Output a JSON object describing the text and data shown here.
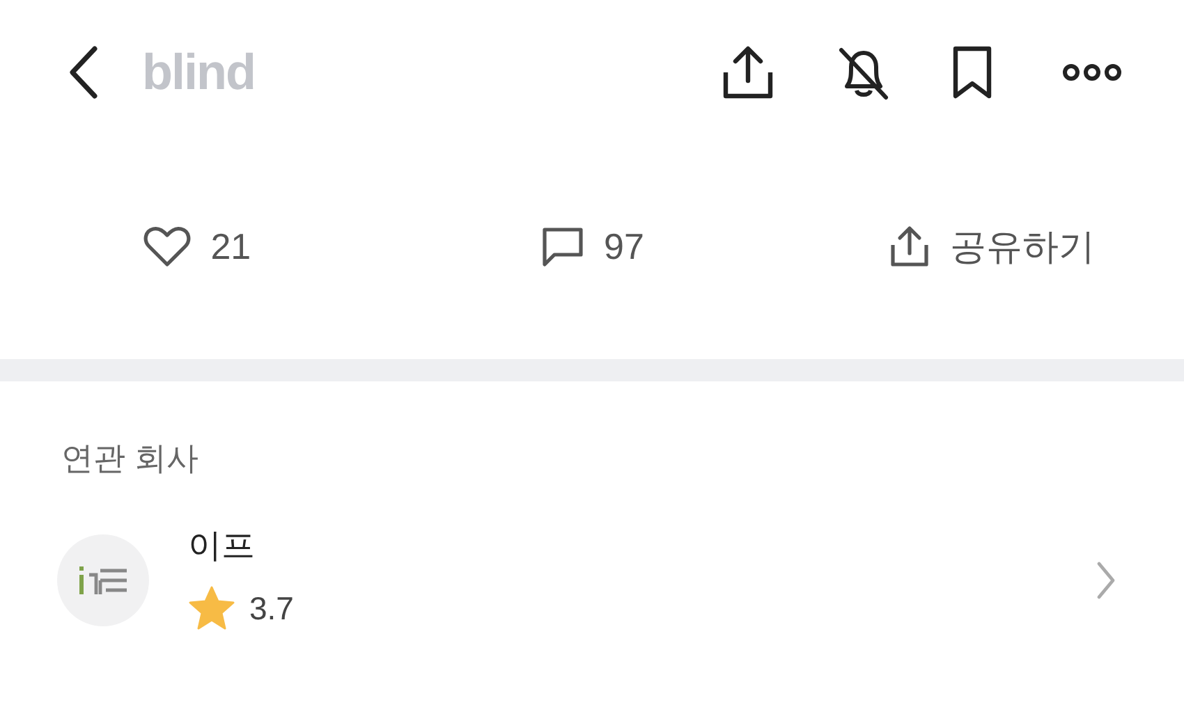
{
  "header": {
    "logo": "blind"
  },
  "actions": [
    {
      "kind": "like",
      "label": "21"
    },
    {
      "kind": "comment",
      "label": "97"
    },
    {
      "kind": "share",
      "label": "공유하기"
    }
  ],
  "related": {
    "title": "연관 회사",
    "companies": [
      {
        "name": "이프",
        "rating": "3.7"
      }
    ]
  }
}
